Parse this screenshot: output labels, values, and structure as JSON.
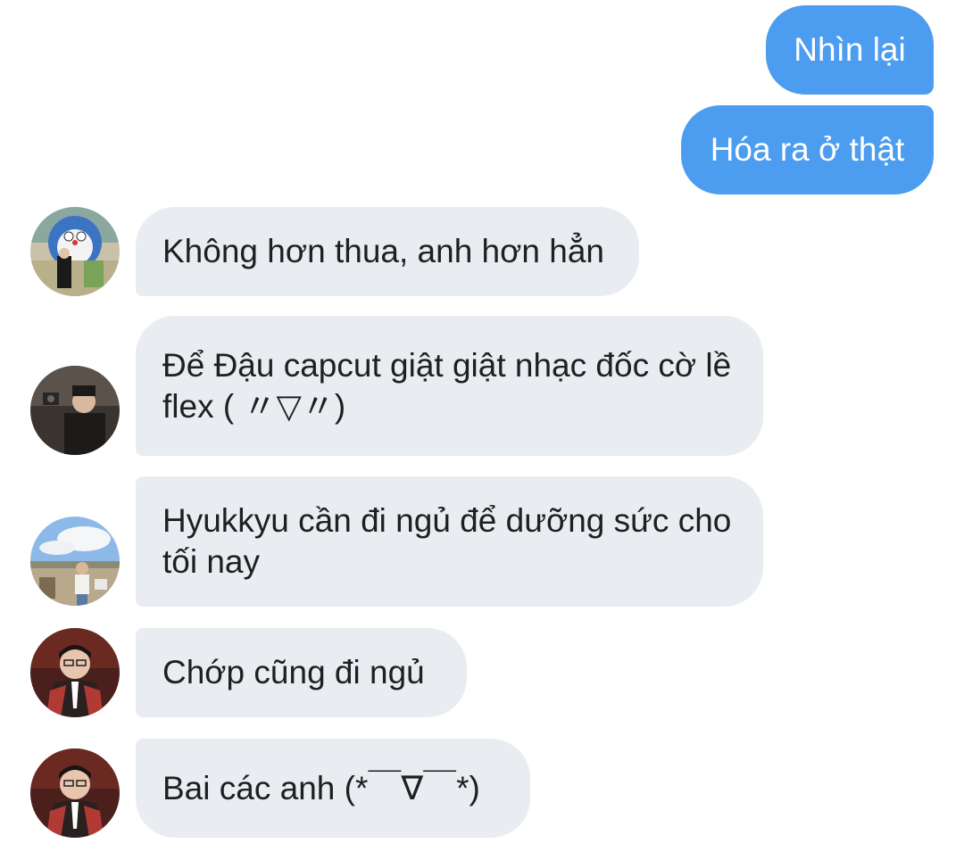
{
  "messages": [
    {
      "sender": "me",
      "text": "Nhìn lại"
    },
    {
      "sender": "me",
      "text": "Hóa ra ở thật"
    },
    {
      "sender": "other",
      "text": "Không hơn thua, anh hơn hẳn"
    },
    {
      "sender": "other",
      "text": "Để Đậu capcut giật giật nhạc đốc cờ lề flex ( 〃▽〃)"
    },
    {
      "sender": "other",
      "text": "Hyukkyu cần đi ngủ để dưỡng sức cho tối nay"
    },
    {
      "sender": "other",
      "text": "Chớp cũng đi ngủ"
    },
    {
      "sender": "other",
      "text": "Bai các anh (*￣∇￣*)"
    }
  ],
  "colors": {
    "sent_bubble": "#4c9df0",
    "received_bubble": "#e9ecf0"
  }
}
